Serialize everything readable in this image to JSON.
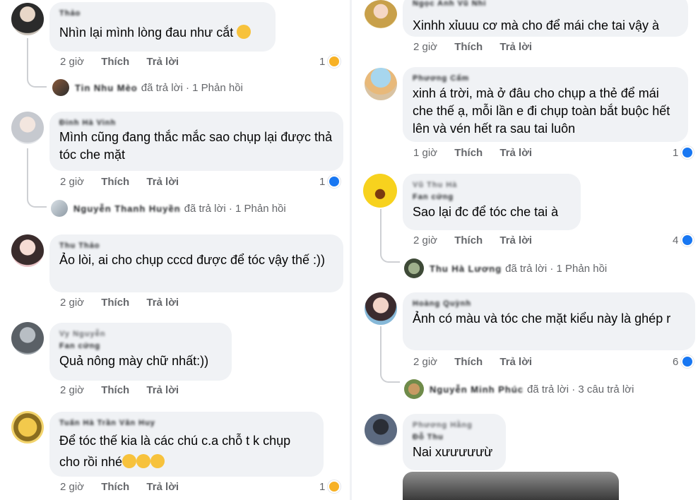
{
  "labels": {
    "like": "Thích",
    "reply": "Trả lời",
    "replied": "đã trả lời",
    "sep": "·"
  },
  "left": [
    {
      "name": "Thảo",
      "time": "2 giờ",
      "text": "Nhìn lại mình lòng đau như cắt",
      "emoji": "slightly-smiling-face",
      "react_count": "1",
      "react_icon": "haha-icon",
      "reply": {
        "name": "Tin Nhu Mèo",
        "summary": "1 Phản hồi"
      }
    },
    {
      "name": "Đinh Hà Vinh",
      "time": "2 giờ",
      "text": "Mình cũng đang thắc mắc sao chụp lại được thả tóc che mặt",
      "react_count": "1",
      "react_icon": "like-icon",
      "reply": {
        "name": "Nguyễn Thanh Huyền",
        "summary": "1 Phản hồi"
      }
    },
    {
      "name": "Thu Thảo",
      "time": "2 giờ",
      "text": "Ảo lòi, ai cho chụp cccd được để tóc vậy thế :))"
    },
    {
      "name": "Vy Nguyễn",
      "name2": "Fan cứng",
      "time": "2 giờ",
      "text": "Quả nông mày chữ nhất:))"
    },
    {
      "name": "Tuấn Hà Trần Văn Huy",
      "time": "2 giờ",
      "text": "Để tóc thế kia là các chú c.a chỗ t k chụp cho rồi nhé",
      "emoji_tail": "crying-laughing-face ×3",
      "react_count": "1",
      "react_icon": "haha-icon"
    }
  ],
  "right": [
    {
      "name": "Ngọc Anh Vũ Nhi",
      "time": "2 giờ",
      "text": "Xinhh xỉuuu cơ mà cho để mái che tai vậy à"
    },
    {
      "name": "Phương Cẩm",
      "time": "1 giờ",
      "text": "xinh á trời, mà ở đâu cho chụp a thẻ để mái che thế ạ, mỗi lần e đi chụp toàn bắt buộc hết lên và vén hết ra sau tai luôn",
      "react_count": "1",
      "react_icon": "like-icon"
    },
    {
      "name": "Vũ Thu Hà",
      "name2": "Fan cứng",
      "time": "2 giờ",
      "text": "Sao lại đc để tóc che tai à",
      "react_count": "4",
      "react_icon": "like-icon",
      "reply": {
        "name": "Thu Hà Lương",
        "summary": "1 Phản hồi"
      }
    },
    {
      "name": "Hoàng Quỳnh",
      "time": "2 giờ",
      "text": "Ảnh có màu và tóc che mặt kiểu này là ghép r",
      "react_count": "6",
      "react_icon": "like-icon",
      "reply": {
        "name": "Nguyễn Minh Phúc",
        "summary": "3 câu trả lời"
      }
    },
    {
      "name": "Phương Hằng",
      "name2": "Đỗ Thu",
      "text": "Nai xưưưưưừ"
    }
  ]
}
